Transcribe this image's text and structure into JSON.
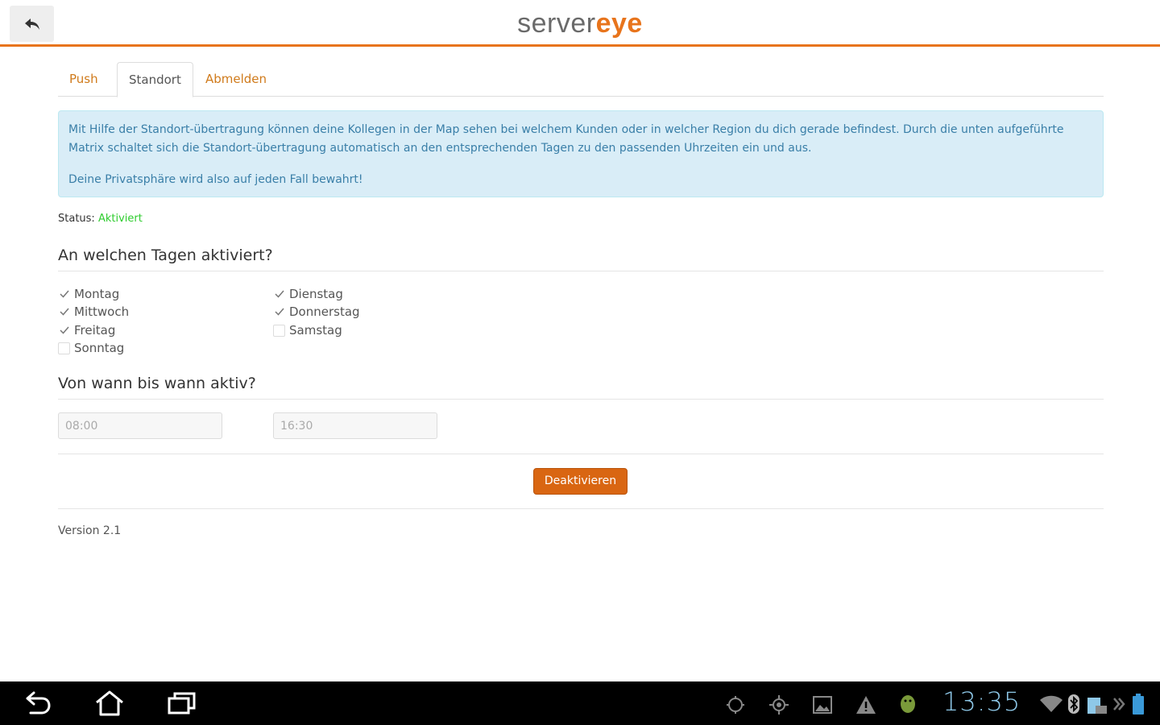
{
  "header": {
    "logo_part1": "server",
    "logo_part2": "eye",
    "brand_color": "#e8741c"
  },
  "tabs": [
    {
      "label": "Push",
      "active": false
    },
    {
      "label": "Standort",
      "active": true
    },
    {
      "label": "Abmelden",
      "active": false
    }
  ],
  "info": {
    "paragraph1": "Mit Hilfe der Standort-übertragung können deine Kollegen in der Map sehen bei welchem Kunden oder in welcher Region du dich gerade befindest. Durch die unten aufgeführte Matrix schaltet sich die Standort-übertragung automatisch an den entsprechenden Tagen zu den passenden Uhrzeiten ein und aus.",
    "paragraph2": "Deine Privatsphäre wird also auf jeden Fall bewahrt!"
  },
  "status": {
    "label": "Status:",
    "value": "Aktiviert"
  },
  "days_section": {
    "title": "An welchen Tagen aktiviert?",
    "days": [
      {
        "label": "Montag",
        "checked": true
      },
      {
        "label": "Dienstag",
        "checked": true
      },
      {
        "label": "Mittwoch",
        "checked": true
      },
      {
        "label": "Donnerstag",
        "checked": true
      },
      {
        "label": "Freitag",
        "checked": true
      },
      {
        "label": "Samstag",
        "checked": false
      },
      {
        "label": "Sonntag",
        "checked": false
      }
    ]
  },
  "times_section": {
    "title": "Von wann bis wann aktiv?",
    "from_value": "08:00",
    "to_value": "16:30"
  },
  "button": {
    "label": "Deaktivieren"
  },
  "footer": {
    "version": "Version 2.1"
  },
  "system_bar": {
    "clock": "13:35"
  }
}
